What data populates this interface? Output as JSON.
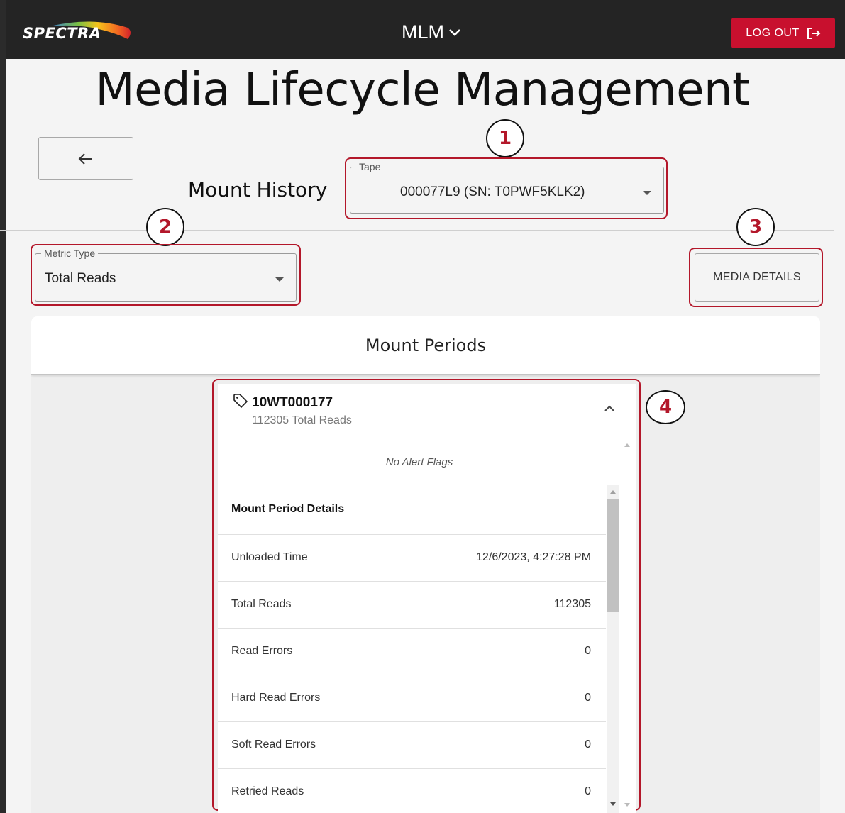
{
  "header": {
    "logo_text": "SPECTRA",
    "app_menu_label": "MLM",
    "logout_label": "LOG OUT"
  },
  "page": {
    "title": "Media Lifecycle Management",
    "section_title": "Mount History"
  },
  "tape_select": {
    "legend": "Tape",
    "value": "000077L9 (SN: T0PWF5KLK2)"
  },
  "metric_select": {
    "legend": "Metric Type",
    "value": "Total Reads"
  },
  "media_details_label": "MEDIA DETAILS",
  "callouts": [
    "1",
    "2",
    "3",
    "4"
  ],
  "panel": {
    "title": "Mount Periods"
  },
  "mount_card": {
    "title": "10WT000177",
    "subtitle": "112305 Total Reads",
    "alert_text": "No Alert Flags",
    "details_heading": "Mount Period Details",
    "rows": [
      {
        "label": "Unloaded Time",
        "value": "12/6/2023, 4:27:28 PM"
      },
      {
        "label": "Total Reads",
        "value": "112305"
      },
      {
        "label": "Read Errors",
        "value": "0"
      },
      {
        "label": "Hard Read Errors",
        "value": "0"
      },
      {
        "label": "Soft Read Errors",
        "value": "0"
      },
      {
        "label": "Retried Reads",
        "value": "0"
      }
    ]
  },
  "colors": {
    "topbar": "#242424",
    "accent_red": "#c8102e",
    "callout_red": "#b3172a"
  }
}
